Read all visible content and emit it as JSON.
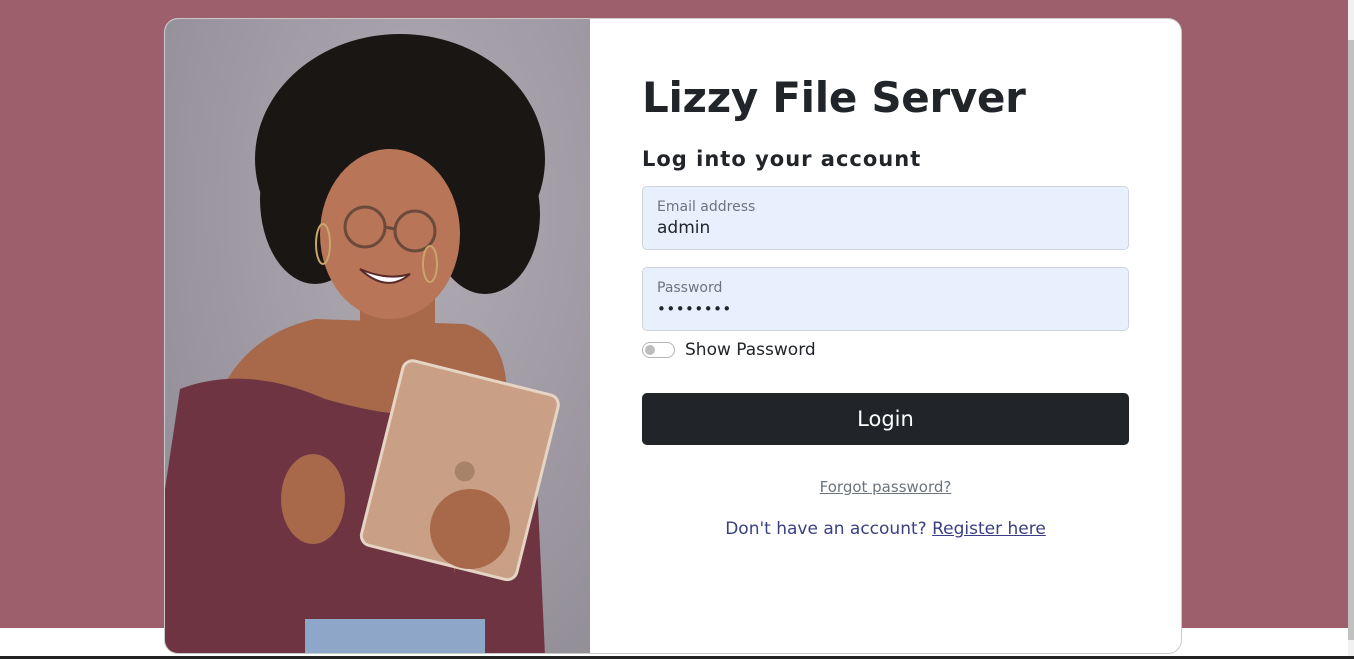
{
  "page": {
    "background_color": "#9c5f6b",
    "accent_color": "#212529",
    "autofill_color": "#e8f0fe"
  },
  "photo": {
    "description_icon": "woman-with-tablet-photo"
  },
  "form": {
    "title": "Lizzy File Server",
    "subtitle": "Log into your account",
    "email": {
      "label": "Email address",
      "value": "admin"
    },
    "password": {
      "label": "Password",
      "value": "••••••••"
    },
    "show_password": {
      "label": "Show Password",
      "checked": false
    },
    "login_label": "Login",
    "forgot_label": "Forgot password?",
    "register_prompt": "Don't have an account? ",
    "register_link": "Register here"
  }
}
